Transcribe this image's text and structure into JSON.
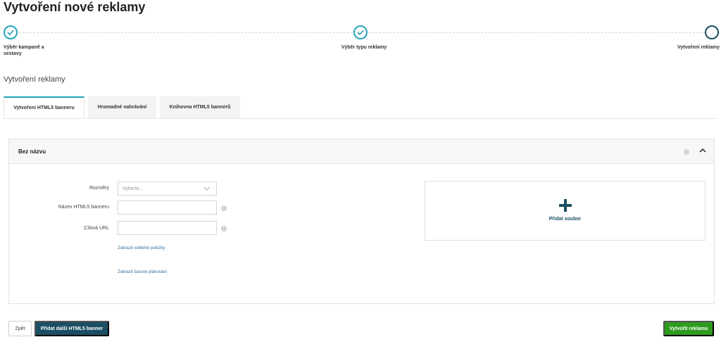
{
  "page": {
    "title": "Vytvoření nové reklamy",
    "section_title": "Vytvoření reklamy"
  },
  "stepper": {
    "steps": [
      {
        "label": "Výběr kampaně a sestavy",
        "status": "done"
      },
      {
        "label": "Výběr typu reklamy",
        "status": "done"
      },
      {
        "label": "Vytvoření reklamy",
        "status": "current"
      }
    ]
  },
  "tabs": [
    {
      "label": "Vytvoření HTML5 banneru",
      "active": true
    },
    {
      "label": "Hromadné nahrávání",
      "active": false
    },
    {
      "label": "Knihovna HTML5 bannerů",
      "active": false
    }
  ],
  "card": {
    "title": "Bez názvu",
    "form": {
      "dimensions_label": "Rozměry",
      "dimensions_placeholder": "Vyberte...",
      "name_label": "Název HTML5 banneru",
      "name_value": "",
      "url_label": "Cílová URL",
      "url_value": "",
      "optional_link": "Zobrazit volitelné položky",
      "schedule_link": "Zobrazit časové plánování"
    },
    "upload": {
      "label": "Přidat soubor"
    }
  },
  "footer": {
    "back_label": "Zpět",
    "add_label": "Přidat další HTML5 banner",
    "create_label": "Vytvořit reklamu"
  },
  "colors": {
    "accent": "#26a3b8",
    "primary": "#1b4e63",
    "success": "#2e9b1f",
    "link": "#2d6fa3"
  }
}
